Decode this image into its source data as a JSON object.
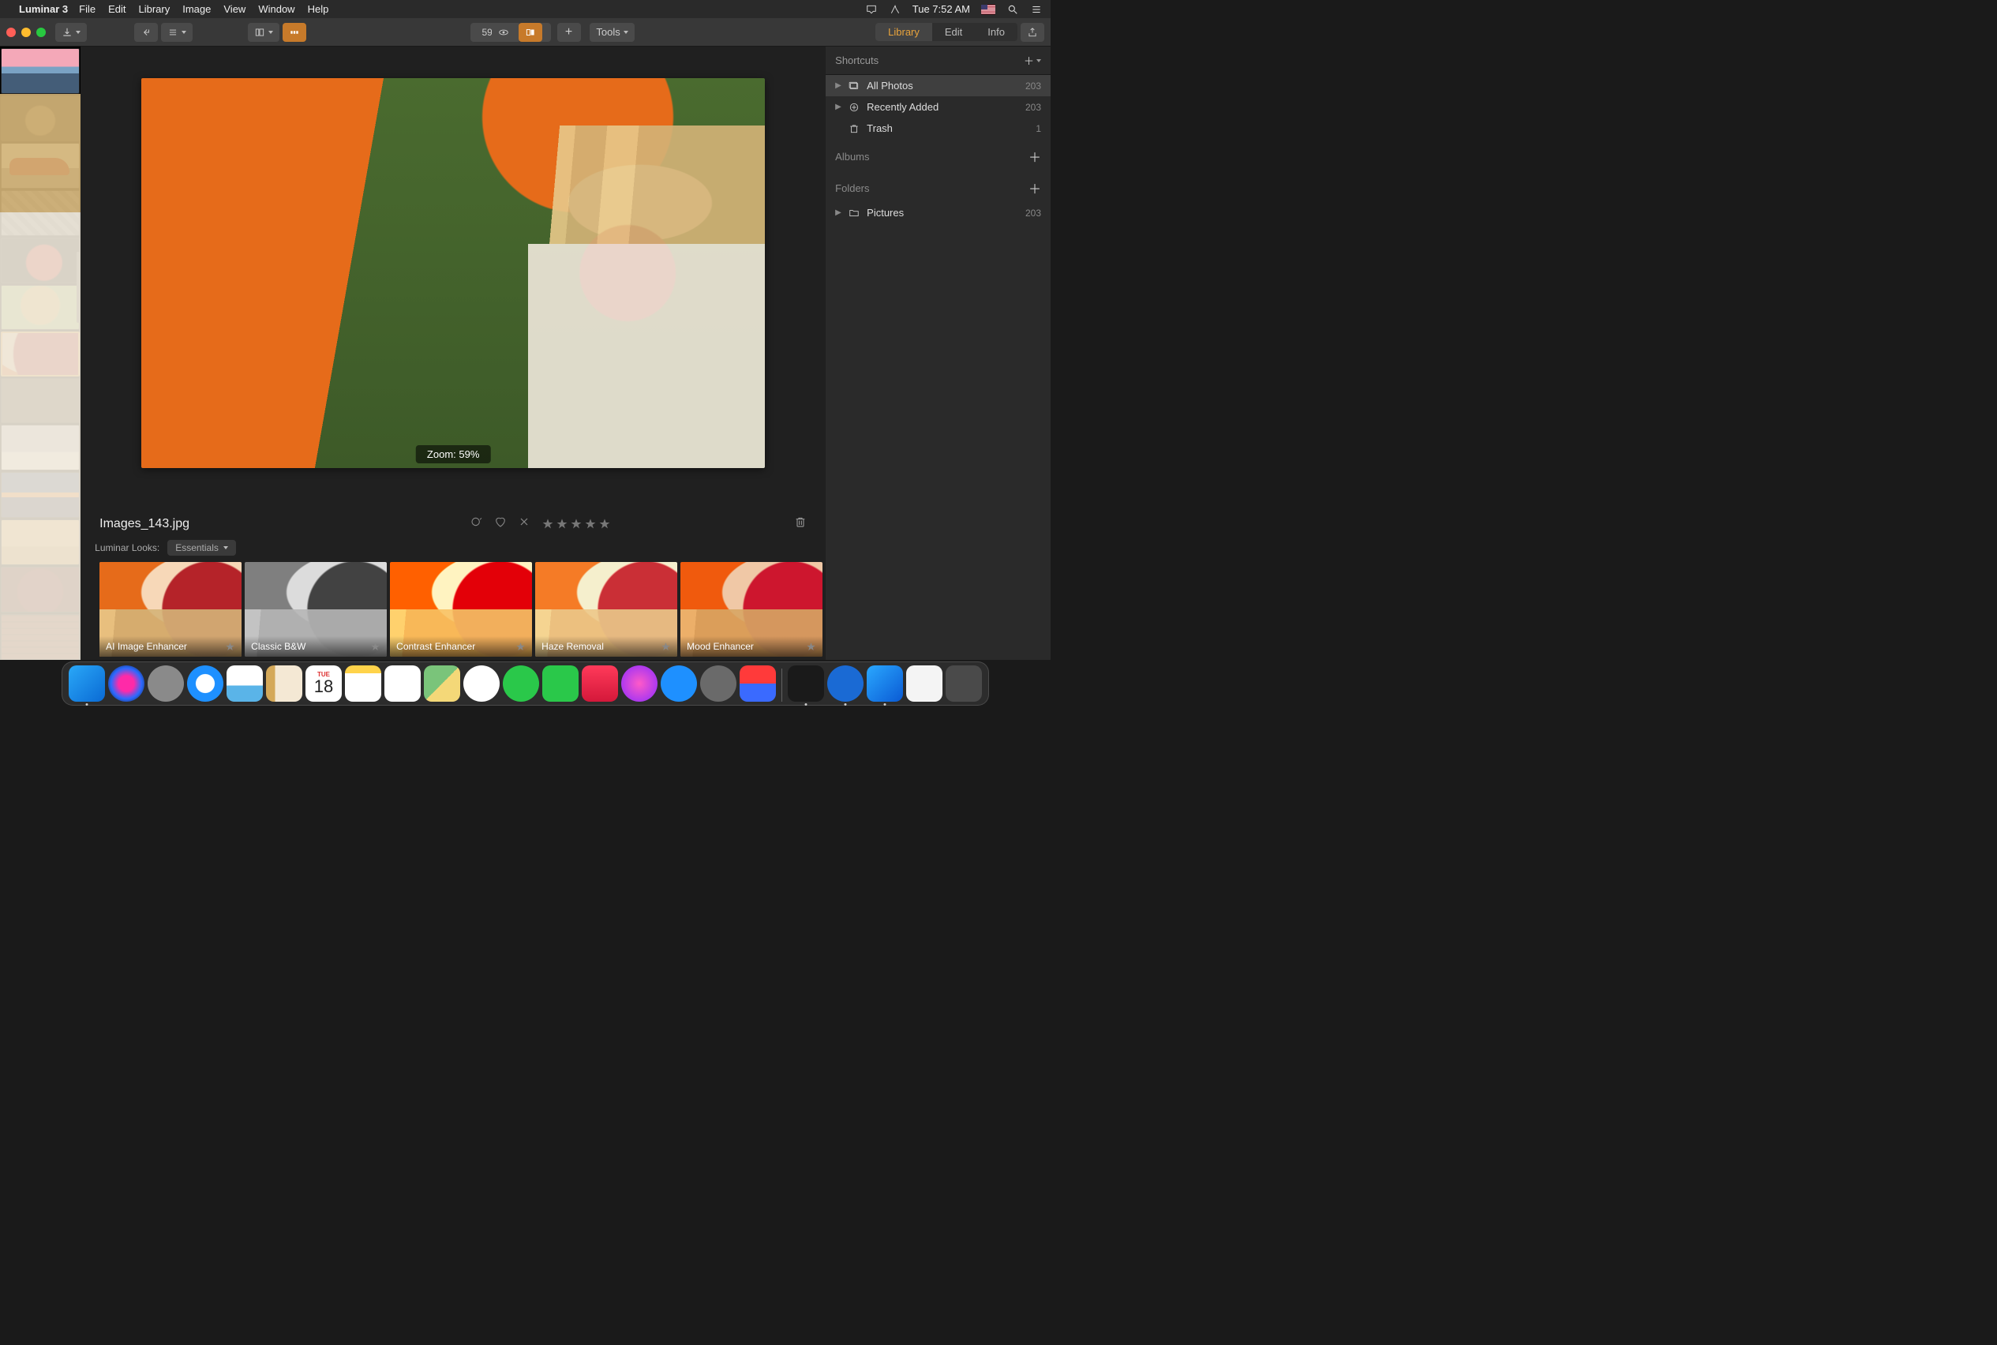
{
  "menubar": {
    "app": "Luminar 3",
    "items": [
      "File",
      "Edit",
      "Library",
      "Image",
      "View",
      "Window",
      "Help"
    ],
    "clock": "Tue 7:52 AM"
  },
  "toolbar": {
    "zoom_percent": "59%",
    "tools_label": "Tools",
    "tabs": {
      "library": "Library",
      "edit": "Edit",
      "info": "Info",
      "active": "library"
    }
  },
  "viewer": {
    "zoom_overlay": "Zoom: 59%",
    "filename": "Images_143.jpg"
  },
  "looks": {
    "label": "Luminar Looks:",
    "category": "Essentials",
    "items": [
      {
        "name": "AI Image Enhancer",
        "css": ""
      },
      {
        "name": "Classic B&W",
        "css": "bw"
      },
      {
        "name": "Contrast Enhancer",
        "css": "contrast"
      },
      {
        "name": "Haze Removal",
        "css": "haze"
      },
      {
        "name": "Mood Enhancer",
        "css": "mood"
      }
    ]
  },
  "sidepanel": {
    "shortcuts_label": "Shortcuts",
    "albums_label": "Albums",
    "folders_label": "Folders",
    "items": {
      "all_photos": {
        "label": "All Photos",
        "count": "203"
      },
      "recently_added": {
        "label": "Recently Added",
        "count": "203"
      },
      "trash": {
        "label": "Trash",
        "count": "1"
      },
      "pictures": {
        "label": "Pictures",
        "count": "203"
      }
    }
  },
  "filmstrip": {
    "thumbs": [
      {
        "css": "t-sunset"
      },
      {
        "css": "t-dark1"
      },
      {
        "css": "t-car"
      },
      {
        "css": "t-gym"
      },
      {
        "css": "t-box"
      },
      {
        "css": "t-food"
      },
      {
        "css": "photo-main",
        "selected": true
      },
      {
        "css": "t-int"
      },
      {
        "css": "t-boats"
      },
      {
        "css": "t-tropic"
      },
      {
        "css": "t-beach"
      },
      {
        "css": "t-cherry"
      },
      {
        "css": "t-brick"
      }
    ]
  },
  "dock": {
    "today": {
      "weekday": "TUE",
      "day": "18"
    },
    "icons": [
      {
        "name": "finder",
        "bg": "linear-gradient(135deg,#2aa8f8,#0a6ad4)"
      },
      {
        "name": "siri",
        "bg": "radial-gradient(circle,#ff2aa8 0 30%,#2a6aff 60%,#111 100%)",
        "round": true
      },
      {
        "name": "launchpad",
        "bg": "#8a8a8a",
        "round": true
      },
      {
        "name": "safari",
        "bg": "radial-gradient(circle,#fff 0 36%,#1e90ff 38% 100%)",
        "round": true
      },
      {
        "name": "mail",
        "bg": "linear-gradient(#fff 0 55%,#5ab4e8 55%)"
      },
      {
        "name": "contacts",
        "bg": "linear-gradient(90deg,#d4a858 0 25%,#f4e8d4 25%)"
      },
      {
        "name": "calendar",
        "bg": "#fff"
      },
      {
        "name": "notes",
        "bg": "linear-gradient(#ffd34a 0 22%,#fff 22%)"
      },
      {
        "name": "reminders",
        "bg": "#fff"
      },
      {
        "name": "maps",
        "bg": "linear-gradient(135deg,#7ac47a 0 50%,#f4d878 50%)"
      },
      {
        "name": "photos",
        "bg": "#fff",
        "round": true
      },
      {
        "name": "messages",
        "bg": "#2ac84a",
        "round": true
      },
      {
        "name": "facetime",
        "bg": "#2ac84a"
      },
      {
        "name": "news",
        "bg": "linear-gradient(#ff3a5a,#d4183a)"
      },
      {
        "name": "itunes",
        "bg": "radial-gradient(circle,#ff5ac8,#8a2aff)",
        "round": true
      },
      {
        "name": "appstore",
        "bg": "#1e90ff",
        "round": true
      },
      {
        "name": "preferences",
        "bg": "#6a6a6a",
        "round": true
      },
      {
        "name": "magnet",
        "bg": "linear-gradient(#ff3a3a 0 50%,#3a6aff 50%)"
      }
    ],
    "right_icons": [
      {
        "name": "terminal",
        "bg": "#1a1a1a"
      },
      {
        "name": "1password",
        "bg": "#1a6ad4",
        "round": true
      },
      {
        "name": "luminar",
        "bg": "linear-gradient(135deg,#2aa8ff,#0a5ad4)"
      },
      {
        "name": "textedit",
        "bg": "#f4f4f4"
      },
      {
        "name": "trash",
        "bg": "#4a4a4a"
      }
    ]
  }
}
